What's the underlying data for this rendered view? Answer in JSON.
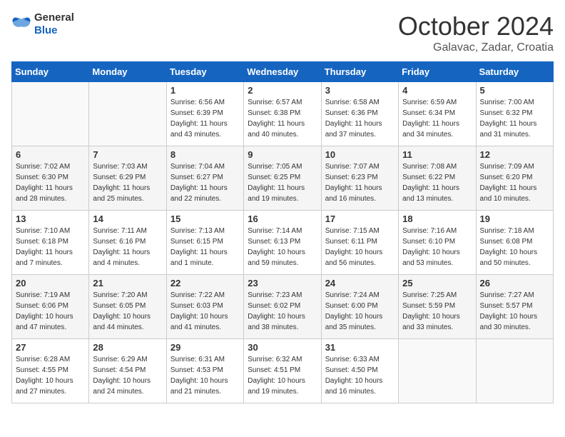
{
  "header": {
    "logo_general": "General",
    "logo_blue": "Blue",
    "month": "October 2024",
    "location": "Galavac, Zadar, Croatia"
  },
  "days_of_week": [
    "Sunday",
    "Monday",
    "Tuesday",
    "Wednesday",
    "Thursday",
    "Friday",
    "Saturday"
  ],
  "weeks": [
    [
      {
        "day": "",
        "sunrise": "",
        "sunset": "",
        "daylight": ""
      },
      {
        "day": "",
        "sunrise": "",
        "sunset": "",
        "daylight": ""
      },
      {
        "day": "1",
        "sunrise": "Sunrise: 6:56 AM",
        "sunset": "Sunset: 6:39 PM",
        "daylight": "Daylight: 11 hours and 43 minutes."
      },
      {
        "day": "2",
        "sunrise": "Sunrise: 6:57 AM",
        "sunset": "Sunset: 6:38 PM",
        "daylight": "Daylight: 11 hours and 40 minutes."
      },
      {
        "day": "3",
        "sunrise": "Sunrise: 6:58 AM",
        "sunset": "Sunset: 6:36 PM",
        "daylight": "Daylight: 11 hours and 37 minutes."
      },
      {
        "day": "4",
        "sunrise": "Sunrise: 6:59 AM",
        "sunset": "Sunset: 6:34 PM",
        "daylight": "Daylight: 11 hours and 34 minutes."
      },
      {
        "day": "5",
        "sunrise": "Sunrise: 7:00 AM",
        "sunset": "Sunset: 6:32 PM",
        "daylight": "Daylight: 11 hours and 31 minutes."
      }
    ],
    [
      {
        "day": "6",
        "sunrise": "Sunrise: 7:02 AM",
        "sunset": "Sunset: 6:30 PM",
        "daylight": "Daylight: 11 hours and 28 minutes."
      },
      {
        "day": "7",
        "sunrise": "Sunrise: 7:03 AM",
        "sunset": "Sunset: 6:29 PM",
        "daylight": "Daylight: 11 hours and 25 minutes."
      },
      {
        "day": "8",
        "sunrise": "Sunrise: 7:04 AM",
        "sunset": "Sunset: 6:27 PM",
        "daylight": "Daylight: 11 hours and 22 minutes."
      },
      {
        "day": "9",
        "sunrise": "Sunrise: 7:05 AM",
        "sunset": "Sunset: 6:25 PM",
        "daylight": "Daylight: 11 hours and 19 minutes."
      },
      {
        "day": "10",
        "sunrise": "Sunrise: 7:07 AM",
        "sunset": "Sunset: 6:23 PM",
        "daylight": "Daylight: 11 hours and 16 minutes."
      },
      {
        "day": "11",
        "sunrise": "Sunrise: 7:08 AM",
        "sunset": "Sunset: 6:22 PM",
        "daylight": "Daylight: 11 hours and 13 minutes."
      },
      {
        "day": "12",
        "sunrise": "Sunrise: 7:09 AM",
        "sunset": "Sunset: 6:20 PM",
        "daylight": "Daylight: 11 hours and 10 minutes."
      }
    ],
    [
      {
        "day": "13",
        "sunrise": "Sunrise: 7:10 AM",
        "sunset": "Sunset: 6:18 PM",
        "daylight": "Daylight: 11 hours and 7 minutes."
      },
      {
        "day": "14",
        "sunrise": "Sunrise: 7:11 AM",
        "sunset": "Sunset: 6:16 PM",
        "daylight": "Daylight: 11 hours and 4 minutes."
      },
      {
        "day": "15",
        "sunrise": "Sunrise: 7:13 AM",
        "sunset": "Sunset: 6:15 PM",
        "daylight": "Daylight: 11 hours and 1 minute."
      },
      {
        "day": "16",
        "sunrise": "Sunrise: 7:14 AM",
        "sunset": "Sunset: 6:13 PM",
        "daylight": "Daylight: 10 hours and 59 minutes."
      },
      {
        "day": "17",
        "sunrise": "Sunrise: 7:15 AM",
        "sunset": "Sunset: 6:11 PM",
        "daylight": "Daylight: 10 hours and 56 minutes."
      },
      {
        "day": "18",
        "sunrise": "Sunrise: 7:16 AM",
        "sunset": "Sunset: 6:10 PM",
        "daylight": "Daylight: 10 hours and 53 minutes."
      },
      {
        "day": "19",
        "sunrise": "Sunrise: 7:18 AM",
        "sunset": "Sunset: 6:08 PM",
        "daylight": "Daylight: 10 hours and 50 minutes."
      }
    ],
    [
      {
        "day": "20",
        "sunrise": "Sunrise: 7:19 AM",
        "sunset": "Sunset: 6:06 PM",
        "daylight": "Daylight: 10 hours and 47 minutes."
      },
      {
        "day": "21",
        "sunrise": "Sunrise: 7:20 AM",
        "sunset": "Sunset: 6:05 PM",
        "daylight": "Daylight: 10 hours and 44 minutes."
      },
      {
        "day": "22",
        "sunrise": "Sunrise: 7:22 AM",
        "sunset": "Sunset: 6:03 PM",
        "daylight": "Daylight: 10 hours and 41 minutes."
      },
      {
        "day": "23",
        "sunrise": "Sunrise: 7:23 AM",
        "sunset": "Sunset: 6:02 PM",
        "daylight": "Daylight: 10 hours and 38 minutes."
      },
      {
        "day": "24",
        "sunrise": "Sunrise: 7:24 AM",
        "sunset": "Sunset: 6:00 PM",
        "daylight": "Daylight: 10 hours and 35 minutes."
      },
      {
        "day": "25",
        "sunrise": "Sunrise: 7:25 AM",
        "sunset": "Sunset: 5:59 PM",
        "daylight": "Daylight: 10 hours and 33 minutes."
      },
      {
        "day": "26",
        "sunrise": "Sunrise: 7:27 AM",
        "sunset": "Sunset: 5:57 PM",
        "daylight": "Daylight: 10 hours and 30 minutes."
      }
    ],
    [
      {
        "day": "27",
        "sunrise": "Sunrise: 6:28 AM",
        "sunset": "Sunset: 4:55 PM",
        "daylight": "Daylight: 10 hours and 27 minutes."
      },
      {
        "day": "28",
        "sunrise": "Sunrise: 6:29 AM",
        "sunset": "Sunset: 4:54 PM",
        "daylight": "Daylight: 10 hours and 24 minutes."
      },
      {
        "day": "29",
        "sunrise": "Sunrise: 6:31 AM",
        "sunset": "Sunset: 4:53 PM",
        "daylight": "Daylight: 10 hours and 21 minutes."
      },
      {
        "day": "30",
        "sunrise": "Sunrise: 6:32 AM",
        "sunset": "Sunset: 4:51 PM",
        "daylight": "Daylight: 10 hours and 19 minutes."
      },
      {
        "day": "31",
        "sunrise": "Sunrise: 6:33 AM",
        "sunset": "Sunset: 4:50 PM",
        "daylight": "Daylight: 10 hours and 16 minutes."
      },
      {
        "day": "",
        "sunrise": "",
        "sunset": "",
        "daylight": ""
      },
      {
        "day": "",
        "sunrise": "",
        "sunset": "",
        "daylight": ""
      }
    ]
  ]
}
